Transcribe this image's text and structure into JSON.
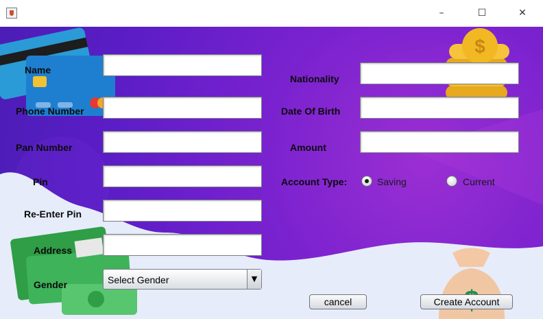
{
  "window": {
    "controls": {
      "minimize": "–",
      "maximize": "☐",
      "close": "✕"
    }
  },
  "form": {
    "left_labels": {
      "name": "Name",
      "phone": "Phone Number",
      "pan": "Pan Number",
      "pin": "Pin",
      "reenter_pin": "Re-Enter Pin",
      "address": "Address",
      "gender": "Gender"
    },
    "right_labels": {
      "nationality": "Nationality",
      "dob": "Date Of Birth",
      "amount": "Amount",
      "account_type": "Account Type:"
    },
    "gender_select": {
      "selected": "Select Gender",
      "arrow": "▼"
    },
    "account_types": [
      {
        "label": "Saving",
        "selected": true
      },
      {
        "label": "Current",
        "selected": false
      }
    ]
  },
  "buttons": {
    "cancel": "cancel",
    "create": "Create Account"
  },
  "colors": {
    "background_purple": "#5b1dc6",
    "accent_magenta": "#9b2fd3",
    "wave": "#e6ecf9"
  }
}
